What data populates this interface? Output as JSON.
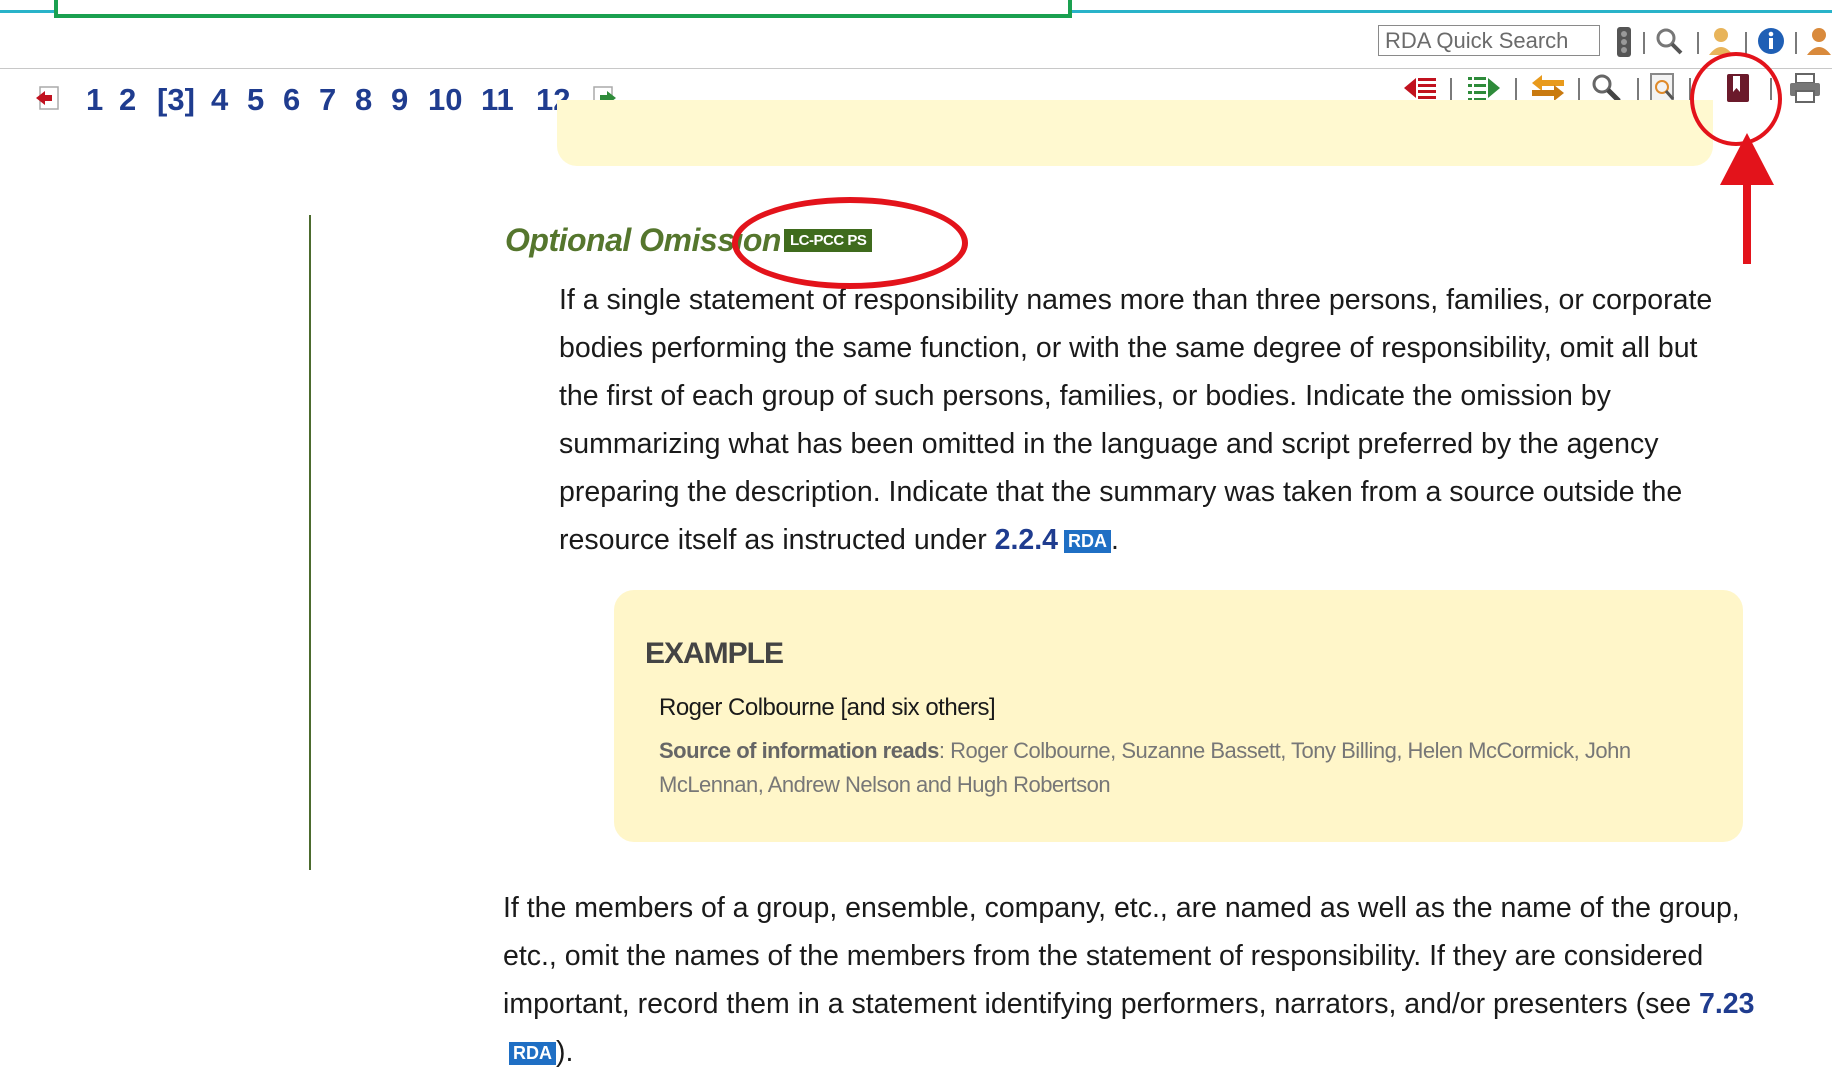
{
  "header": {
    "search": {
      "placeholder": "RDA Quick Search"
    },
    "top_icons": [
      "traffic-light-icon",
      "magnifier-icon",
      "user-icon",
      "info-icon",
      "user-icon"
    ],
    "toolbar_icons": [
      "toc-back-icon",
      "toc-forward-icon",
      "sync-icon",
      "search-icon",
      "preview-icon",
      "bookmark-icon",
      "print-icon"
    ]
  },
  "pager": {
    "pages": [
      "1",
      "2",
      "[3]",
      "4",
      "5",
      "6",
      "7",
      "8",
      "9",
      "10",
      "11",
      "12"
    ],
    "current": "[3]"
  },
  "content": {
    "optional_omission": {
      "title": "Optional Omission",
      "badge": "LC-PCC PS",
      "text_before": "If a single statement of responsibility names more than three persons, families, or corporate bodies performing the same function, or with the same degree of responsibility, omit all but the first of each group of such persons, families, or bodies. Indicate the omission by summarizing what has been omitted in the language and script preferred by the agency preparing the description. Indicate that the summary was taken from a source outside the resource itself as instructed under ",
      "ref": "2.2.4",
      "rda_label": "RDA",
      "text_after": "."
    },
    "example": {
      "title": "EXAMPLE",
      "line1": "Roger Colbourne [and six others]",
      "source_label": "Source of information reads",
      "source_text": ": Roger Colbourne, Suzanne Bassett, Tony Billing, Helen McCormick, John McLennan, Andrew Nelson and Hugh Robertson"
    },
    "members": {
      "text_before": "If the members of a group, ensemble, company, etc., are named as well as the name of the group, etc., omit the names of the members from the statement of responsibility. If they are considered important, record them in a statement identifying performers, narrators, and/or presenters (see ",
      "ref": "7.23",
      "rda_label": "RDA",
      "text_after": ")."
    }
  },
  "colors": {
    "annotation_red": "#e3131b",
    "link_blue": "#1f3c8f",
    "title_green": "#55762d",
    "example_bg": "#fff6c9"
  }
}
